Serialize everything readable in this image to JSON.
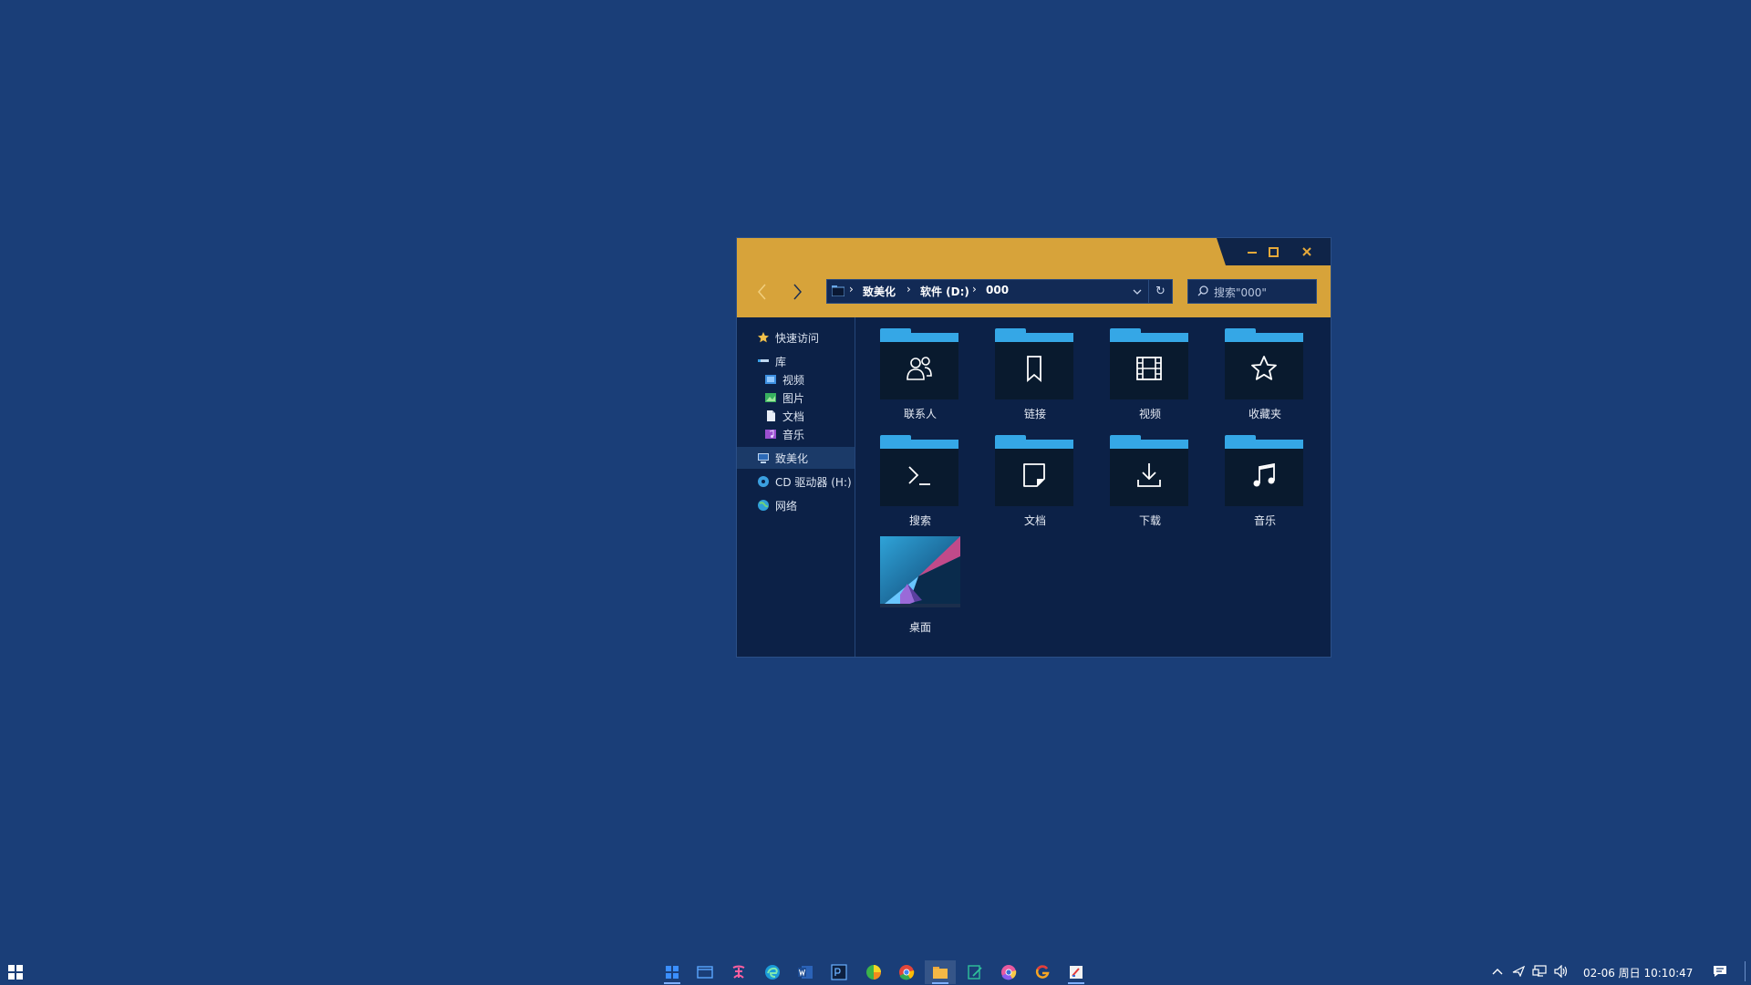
{
  "window": {
    "address": {
      "crumbs": [
        "致美化",
        "软件 (D:)",
        "000"
      ],
      "separator": "›",
      "refresh_glyph": "↻"
    },
    "search": {
      "placeholder": "搜索\"000\""
    },
    "caption_buttons": [
      "minimize-icon",
      "maximize-icon",
      "close-icon"
    ],
    "nav_pane": {
      "quick_access": "快速访问",
      "library": "库",
      "library_items": [
        "视频",
        "图片",
        "文档",
        "音乐"
      ],
      "this_pc": "致美化",
      "cd_drive": "CD 驱动器 (H:)",
      "network": "网络"
    },
    "items": [
      {
        "label": "联系人",
        "icon": "contacts-icon"
      },
      {
        "label": "链接",
        "icon": "bookmark-icon"
      },
      {
        "label": "视频",
        "icon": "film-icon"
      },
      {
        "label": "收藏夹",
        "icon": "star-icon"
      },
      {
        "label": "搜索",
        "icon": "terminal-icon"
      },
      {
        "label": "文档",
        "icon": "document-icon"
      },
      {
        "label": "下载",
        "icon": "download-icon"
      },
      {
        "label": "音乐",
        "icon": "music-icon"
      },
      {
        "label": "桌面",
        "icon": "desktop-thumbnail"
      }
    ]
  },
  "taskbar": {
    "clock": "02-06 周日 10:10:47",
    "apps": [
      "start-icon",
      "task-view-icon",
      "xiuxiu-icon",
      "edge-icon",
      "word-icon",
      "photoshop-icon",
      "paint-ball-icon",
      "chrome-icon",
      "explorer-icon",
      "notepad-icon",
      "chrome-canary-icon",
      "grammarly-icon",
      "sketch-icon"
    ]
  },
  "colors": {
    "desktop": "#1a3e78",
    "titlebar": "#d7a33a",
    "folder": "#35a7e6",
    "window_body": "#0c2147"
  }
}
